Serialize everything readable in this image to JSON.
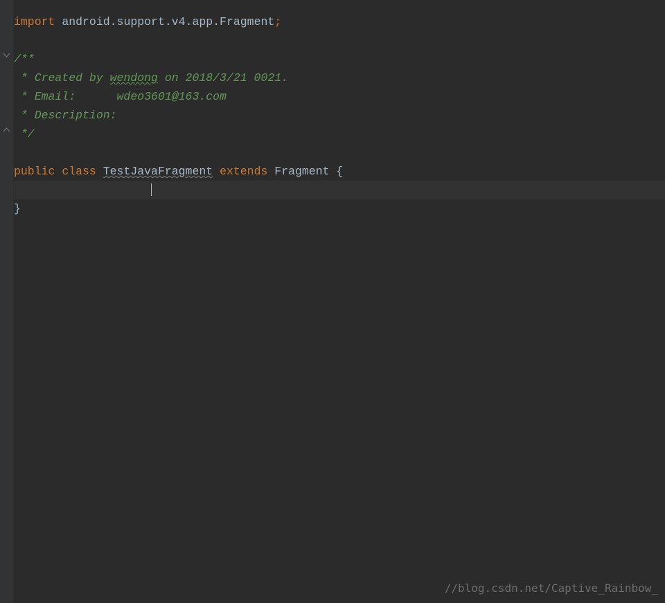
{
  "code": {
    "importKw": "import",
    "importPkg": " android.support.v4.app.Fragment",
    "semicolon": ";",
    "commentOpen": "/**",
    "commentLine1a": " * Created by ",
    "commentAuthor": "wendong",
    "commentLine1b": " on 2018/3/21 0021.",
    "commentLine2a": " * Email:      ",
    "commentEmail": "wdeo3601@163.com",
    "commentLine3": " * Description:",
    "commentClose": " */",
    "publicKw": "public ",
    "classKw": "class ",
    "className": "TestJavaFragment",
    "extendsKw": " extends ",
    "superClass": "Fragment ",
    "openBrace": "{",
    "cursorIndent": "                    ",
    "closeBrace": "}"
  },
  "watermark": "//blog.csdn.net/Captive_Rainbow_"
}
